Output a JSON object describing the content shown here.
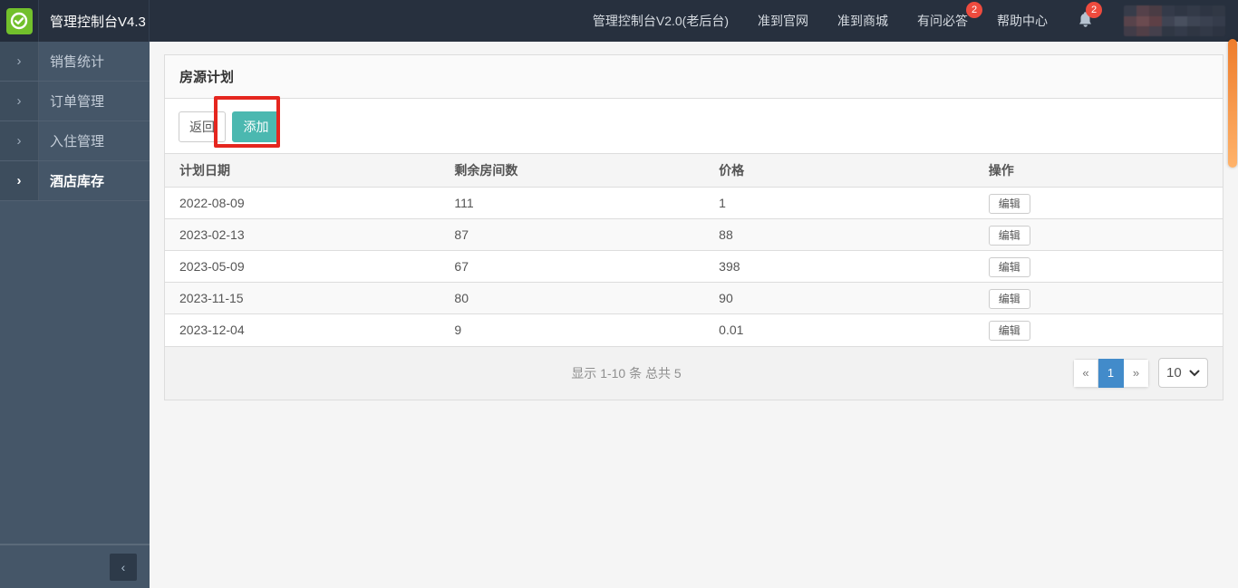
{
  "header": {
    "title": "管理控制台V4.3",
    "nav": [
      {
        "label": "管理控制台V2.0(老后台)"
      },
      {
        "label": "准到官网"
      },
      {
        "label": "准到商城"
      },
      {
        "label": "有问必答",
        "badge": "2"
      },
      {
        "label": "帮助中心"
      }
    ],
    "bell_badge": "2"
  },
  "sidebar": {
    "chevron": "›",
    "items": [
      {
        "label": "销售统计"
      },
      {
        "label": "订单管理"
      },
      {
        "label": "入住管理"
      },
      {
        "label": "酒店库存"
      }
    ],
    "collapse_icon": "‹"
  },
  "panel": {
    "title": "房源计划",
    "back_button": "返回",
    "add_button": "添加",
    "table": {
      "columns": [
        "计划日期",
        "剩余房间数",
        "价格",
        "操作"
      ],
      "rows": [
        {
          "date": "2022-08-09",
          "rooms": "111",
          "price": "1",
          "action": "编辑"
        },
        {
          "date": "2023-02-13",
          "rooms": "87",
          "price": "88",
          "action": "编辑"
        },
        {
          "date": "2023-05-09",
          "rooms": "67",
          "price": "398",
          "action": "编辑"
        },
        {
          "date": "2023-11-15",
          "rooms": "80",
          "price": "90",
          "action": "编辑"
        },
        {
          "date": "2023-12-04",
          "rooms": "9",
          "price": "0.01",
          "action": "编辑"
        }
      ]
    },
    "pagination": {
      "summary": "显示 1-10 条 总共 5",
      "prev": "«",
      "current": "1",
      "next": "»",
      "page_size": "10"
    }
  },
  "colors": {
    "header_bg": "#27303e",
    "sidebar_bg": "#455668",
    "logo_green": "#72c02c",
    "accent_teal": "#4bb8b0",
    "badge_red": "#ee4b3e",
    "active_page_blue": "#428bca",
    "annotation_red": "#e5261f",
    "scrollbar_orange": "#ee7c2b"
  }
}
